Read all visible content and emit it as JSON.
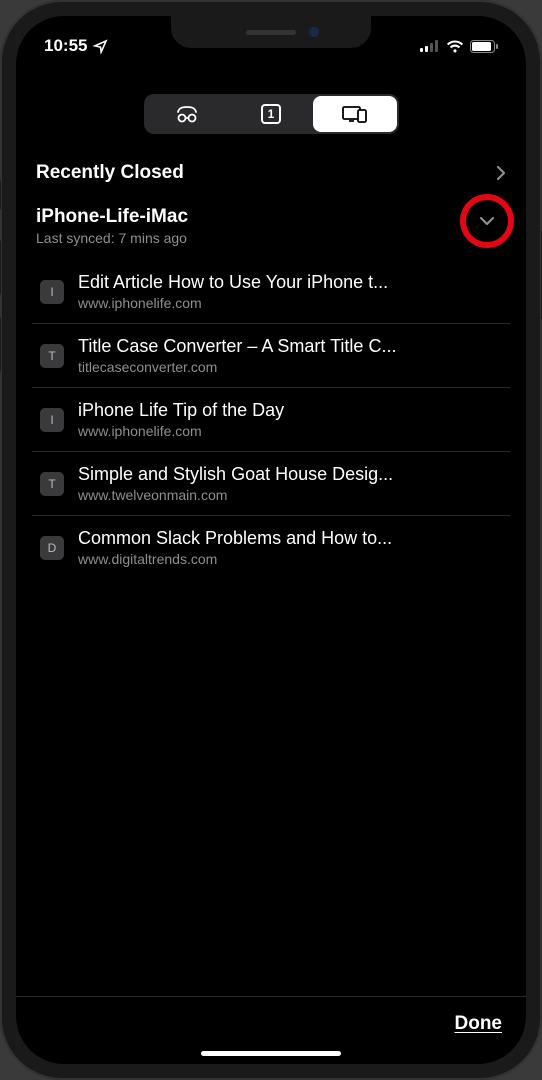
{
  "status": {
    "time": "10:55",
    "location_icon": "location-arrow-icon",
    "signal_bars": 2,
    "wifi": true,
    "battery_pct": 85
  },
  "segments": {
    "incognito_icon": "incognito-icon",
    "tab_count": "1",
    "devices_icon": "devices-icon",
    "active_index": 2
  },
  "recently_closed": {
    "label": "Recently Closed"
  },
  "device": {
    "name": "iPhone-Life-iMac",
    "sync_line": "Last synced: 7 mins ago"
  },
  "tabs": [
    {
      "favicon_letter": "I",
      "title": "Edit Article How to Use Your iPhone t...",
      "domain": "www.iphonelife.com"
    },
    {
      "favicon_letter": "T",
      "title": "Title Case Converter – A Smart Title C...",
      "domain": "titlecaseconverter.com"
    },
    {
      "favicon_letter": "I",
      "title": "iPhone Life Tip of the Day",
      "domain": "www.iphonelife.com"
    },
    {
      "favicon_letter": "T",
      "title": "Simple and Stylish Goat House Desig...",
      "domain": "www.twelveonmain.com"
    },
    {
      "favicon_letter": "D",
      "title": "Common Slack Problems and How to...",
      "domain": "www.digitaltrends.com"
    }
  ],
  "footer": {
    "done": "Done"
  },
  "annotation": {
    "circle_target": "device-expand-chevron"
  }
}
